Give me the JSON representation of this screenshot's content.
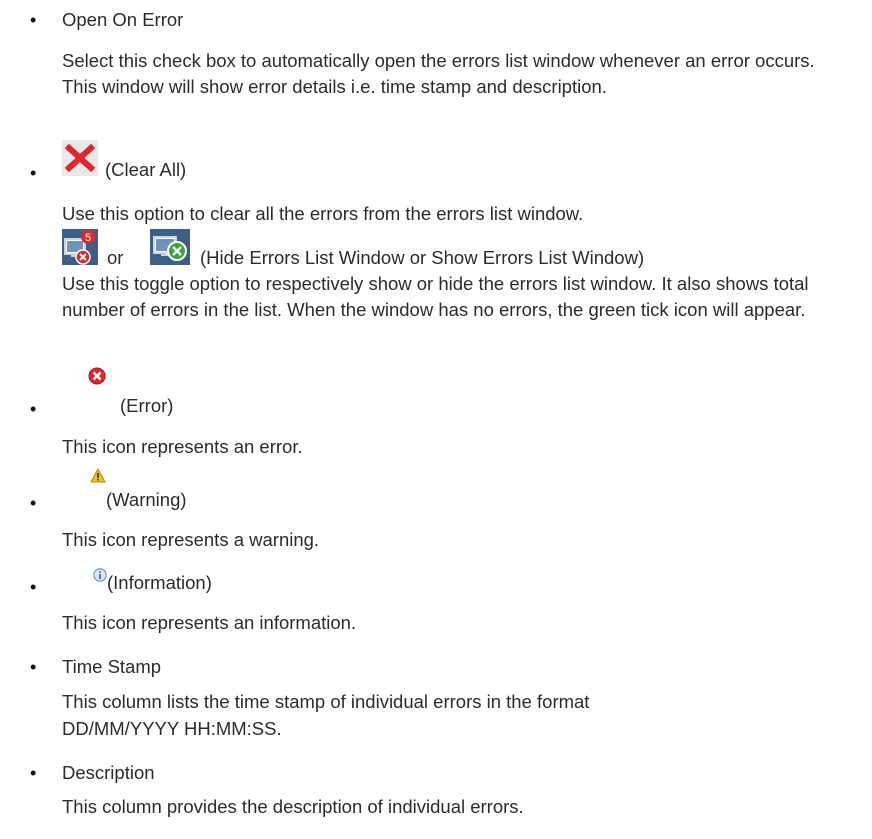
{
  "items": [
    {
      "title": "Open On Error",
      "desc": "Select this check box to automatically open the errors list window whenever an error occurs. This window will show error details i.e. time stamp and description."
    },
    {
      "icon": "red-x-icon",
      "title": "(Clear All)",
      "desc": "Use this option to clear all the errors from the errors list window."
    },
    {
      "icon1": "hide-errors-list-icon",
      "badge_count": "5",
      "or_text": "or",
      "icon2": "show-errors-list-icon",
      "title": "(Hide Errors List Window or Show Errors List Window)",
      "desc": "Use this toggle option to respectively show or hide the errors list window. It also shows total number of errors in the list.  When the window has no errors, the green tick icon will appear."
    },
    {
      "icon": "error-icon",
      "title": "(Error)",
      "desc": "This icon represents an error."
    },
    {
      "icon": "warning-icon",
      "title": "(Warning)",
      "desc": "This icon represents a warning."
    },
    {
      "icon": "information-icon",
      "title": "(Information)",
      "desc": "This icon represents an information."
    },
    {
      "title": "Time Stamp",
      "desc_line1": "This column lists the time stamp of individual errors in the format",
      "desc_line2": "DD/MM/YYYY HH:MM:SS."
    },
    {
      "title": "Description",
      "desc": "This column provides the description of individual errors."
    }
  ],
  "colors": {
    "text": "#2b2b2b",
    "error_red": "#e0262b",
    "warning_yellow": "#f3c31b",
    "info_blue": "#5a86d6",
    "monitor_blue": "#4b7fb3",
    "success_green": "#3aa43a"
  }
}
